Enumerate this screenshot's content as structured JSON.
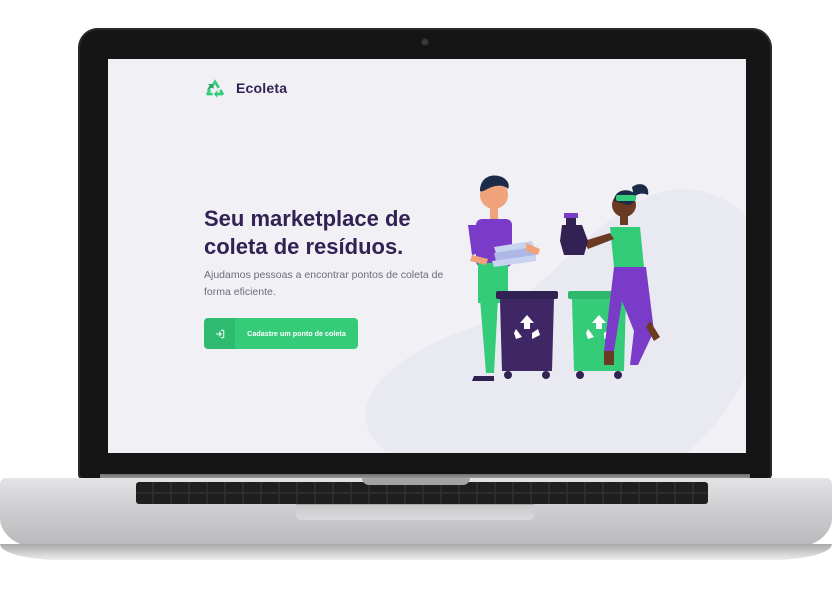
{
  "app": {
    "name": "Ecoleta"
  },
  "hero": {
    "title_line1": "Seu marketplace de",
    "title_line2": "coleta de resíduos.",
    "description": "Ajudamos pessoas a encontrar pontos de coleta de forma eficiente."
  },
  "cta": {
    "label": "Cadastre um ponto de coleta",
    "icon": "log-in-icon"
  },
  "colors": {
    "brand_green": "#34cb79",
    "title_purple": "#322153",
    "text_gray": "#6c6c80",
    "background": "#f0f0f5"
  },
  "illustration": {
    "icons": [
      "recycle-bin-dark-icon",
      "recycle-bin-green-icon",
      "person-man",
      "person-woman"
    ]
  }
}
